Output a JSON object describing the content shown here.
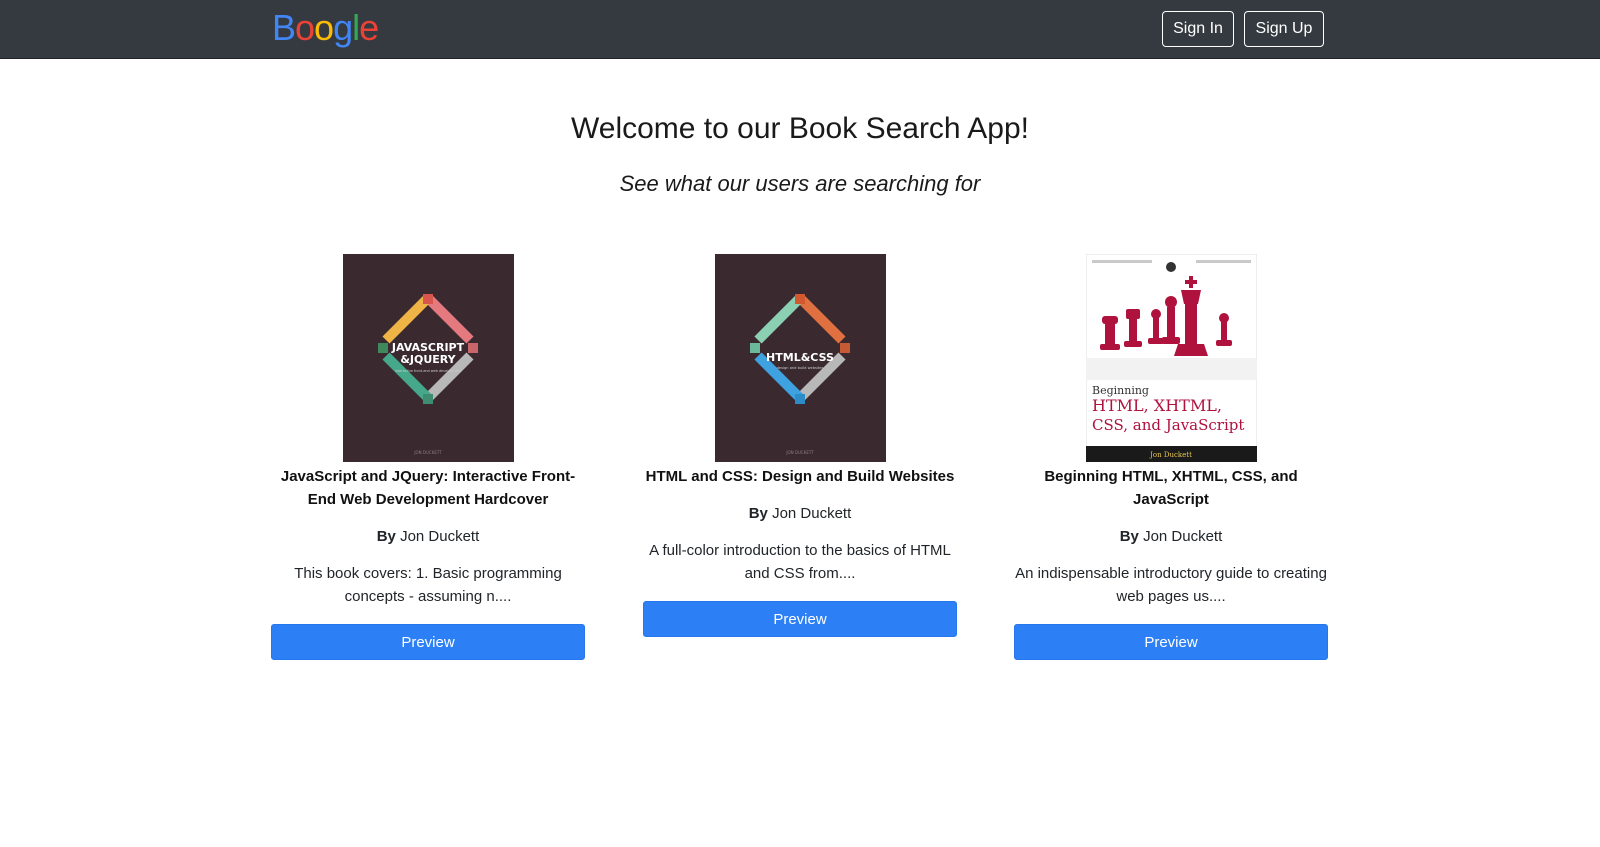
{
  "navbar": {
    "logo_letters": [
      {
        "char": "B",
        "color": "#4285f4"
      },
      {
        "char": "o",
        "color": "#ea4335"
      },
      {
        "char": "o",
        "color": "#fbbc05"
      },
      {
        "char": "g",
        "color": "#4285f4"
      },
      {
        "char": "l",
        "color": "#34a853"
      },
      {
        "char": "e",
        "color": "#ea4335"
      }
    ],
    "sign_in_label": "Sign In",
    "sign_up_label": "Sign Up"
  },
  "hero": {
    "title": "Welcome to our Book Search App!",
    "subtitle": "See what our users are searching for"
  },
  "books": [
    {
      "title": "JavaScript and JQuery: Interactive Front-End Web Development Hardcover",
      "by_label": "By",
      "author": "Jon Duckett",
      "description": "This book covers: 1. Basic programming concepts - assuming n....",
      "preview_label": "Preview",
      "cover": {
        "line1": "JAVASCRIPT",
        "line2": "&JQUERY",
        "tagline": "interactive front-end web development",
        "author": "JON DUCKETT",
        "background": "#3a2a30"
      }
    },
    {
      "title": "HTML and CSS: Design and Build Websites",
      "by_label": "By",
      "author": "Jon Duckett",
      "description": "A full-color introduction to the basics of HTML and CSS from....",
      "preview_label": "Preview",
      "cover": {
        "line1": "HTML&CSS",
        "tagline": "design and build websites",
        "author": "JON DUCKETT",
        "background": "#3a2a30"
      }
    },
    {
      "title": "Beginning HTML, XHTML, CSS, and JavaScript",
      "by_label": "By",
      "author": "Jon Duckett",
      "description": "An indispensable introductory guide to creating web pages us....",
      "preview_label": "Preview",
      "cover": {
        "line1": "Beginning",
        "line2": "HTML, XHTML,",
        "line3": "CSS, and JavaScript",
        "author": "Jon Duckett",
        "accent": "#b0123e"
      }
    }
  ]
}
